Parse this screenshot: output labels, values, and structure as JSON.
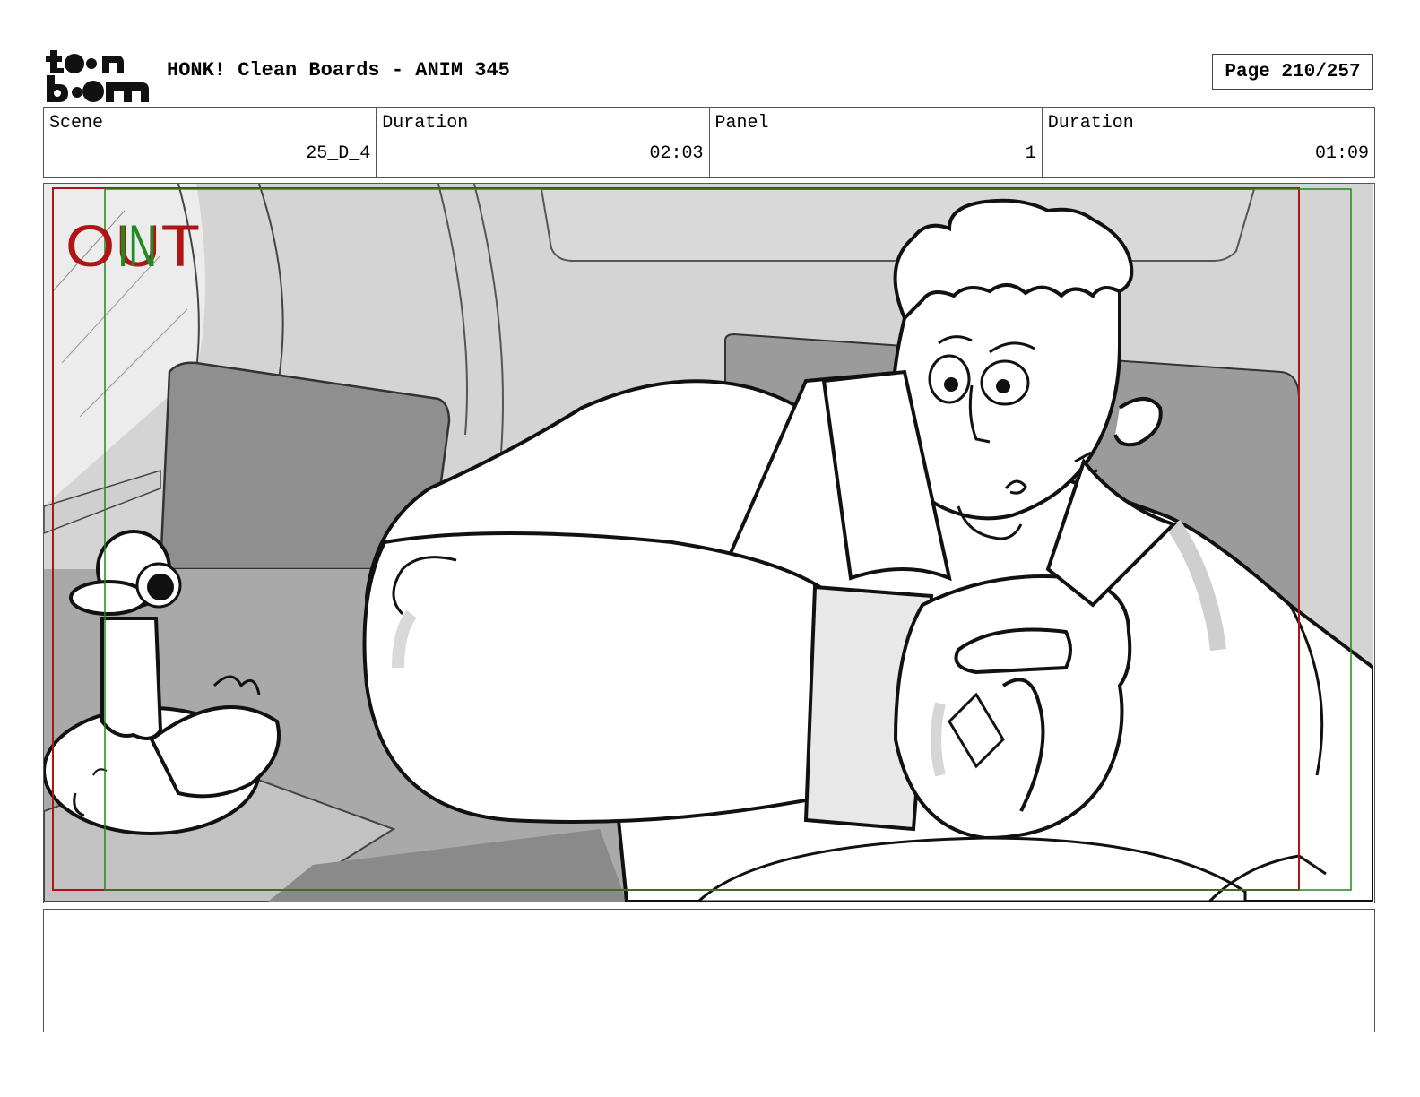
{
  "header": {
    "logo_text": "toon boom",
    "title": "HONK! Clean Boards - ANIM 345",
    "page": "Page 210/257"
  },
  "info": {
    "scene_label": "Scene",
    "scene_value": "25_D_4",
    "scene_duration_label": "Duration",
    "scene_duration_value": "02:03",
    "panel_label": "Panel",
    "panel_value": "1",
    "panel_duration_label": "Duration",
    "panel_duration_value": "01:09"
  },
  "panel": {
    "out_label": "OUT",
    "in_label": "IN",
    "out_color": "#b01515",
    "in_color": "#1f8a1f"
  },
  "notes": {
    "text": ""
  }
}
